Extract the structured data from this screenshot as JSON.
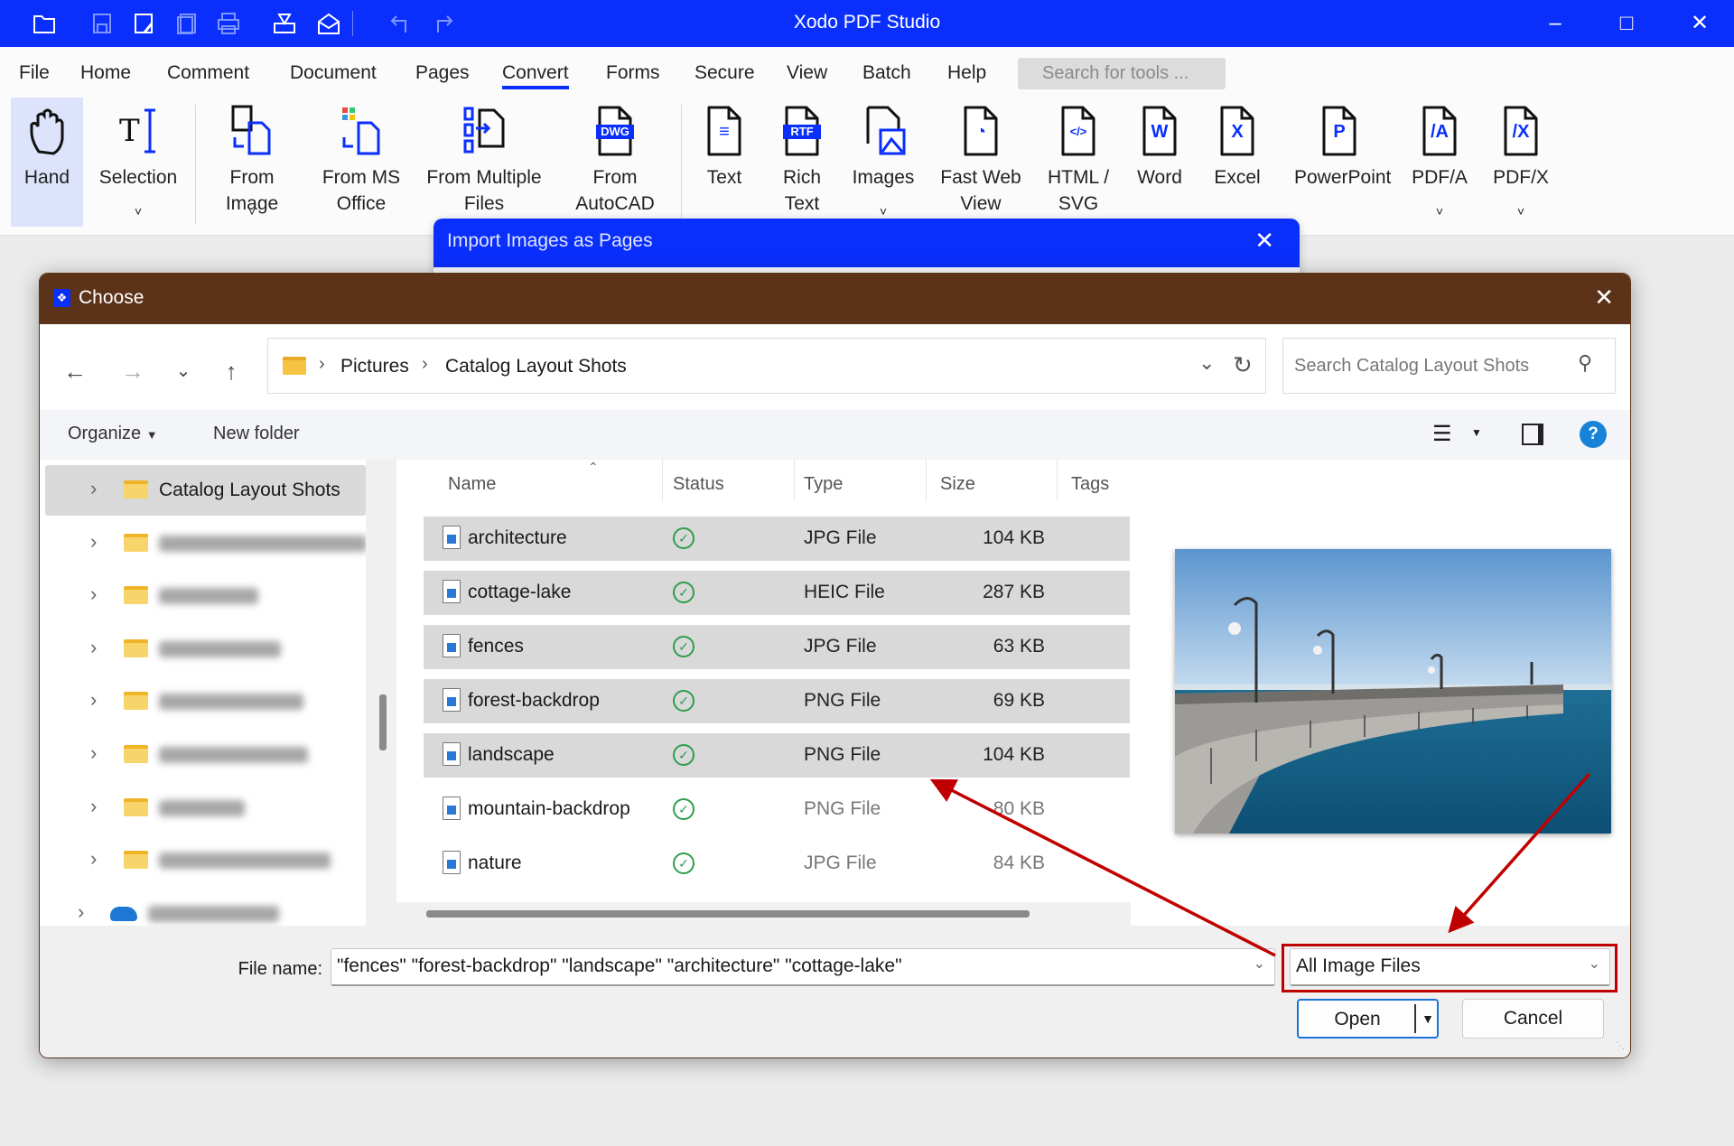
{
  "app": {
    "title": "Xodo PDF Studio"
  },
  "quick_access": [
    "open-folder",
    "save",
    "save-as",
    "save-all",
    "print",
    "scan",
    "email",
    "undo",
    "redo"
  ],
  "menu": {
    "items": [
      "File",
      "Home",
      "Comment",
      "Document",
      "Pages",
      "Convert",
      "Forms",
      "Secure",
      "View",
      "Batch",
      "Help"
    ],
    "active": "Convert",
    "search_placeholder": "Search for tools ..."
  },
  "ribbon": [
    {
      "label": "Hand",
      "icon": "hand",
      "active": true
    },
    {
      "label": "Selection",
      "icon": "text-select",
      "dropdown": true
    },
    {
      "label": "From\nImage",
      "icon": "image-to-pdf",
      "dropdown": true
    },
    {
      "label": "From MS\nOffice",
      "icon": "office-to-pdf"
    },
    {
      "label": "From Multiple\nFiles",
      "icon": "multiple-files"
    },
    {
      "label": "From\nAutoCAD",
      "icon": "dwg-file",
      "badge": "DWG"
    },
    {
      "label": "Text",
      "icon": "text-file",
      "badge": "≡"
    },
    {
      "label": "Rich\nText",
      "icon": "rtf-file",
      "badge": "RTF"
    },
    {
      "label": "Images",
      "icon": "images-file",
      "dropdown": true
    },
    {
      "label": "Fast Web\nView",
      "icon": "fast-web-view",
      "badge": "◔"
    },
    {
      "label": "HTML /\nSVG",
      "icon": "html-file",
      "badge": "</>"
    },
    {
      "label": "Word",
      "icon": "word-file",
      "badge": "W"
    },
    {
      "label": "Excel",
      "icon": "excel-file",
      "badge": "X"
    },
    {
      "label": "PowerPoint",
      "icon": "powerpoint-file",
      "badge": "P"
    },
    {
      "label": "PDF/A",
      "icon": "pdfa-file",
      "badge": "/A",
      "dropdown": true
    },
    {
      "label": "PDF/X",
      "icon": "pdfx-file",
      "badge": "/X",
      "dropdown": true
    }
  ],
  "import_dialog": {
    "title": "Import Images as Pages"
  },
  "choose_dialog": {
    "title": "Choose",
    "breadcrumb": [
      "Pictures",
      "Catalog Layout Shots"
    ],
    "search_placeholder": "Search Catalog Layout Shots",
    "organize": "Organize",
    "new_folder": "New folder",
    "tree": {
      "selected": "Catalog Layout Shots"
    },
    "columns": [
      "Name",
      "Status",
      "Type",
      "Size",
      "Tags"
    ],
    "files": [
      {
        "name": "architecture",
        "type": "JPG File",
        "size": "104 KB",
        "selected": true
      },
      {
        "name": "cottage-lake",
        "type": "HEIC File",
        "size": "287 KB",
        "selected": true
      },
      {
        "name": "fences",
        "type": "JPG File",
        "size": "63 KB",
        "selected": true
      },
      {
        "name": "forest-backdrop",
        "type": "PNG File",
        "size": "69 KB",
        "selected": true
      },
      {
        "name": "landscape",
        "type": "PNG File",
        "size": "104 KB",
        "selected": true
      },
      {
        "name": "mountain-backdrop",
        "type": "PNG File",
        "size": "80 KB",
        "selected": false
      },
      {
        "name": "nature",
        "type": "JPG File",
        "size": "84 KB",
        "selected": false
      }
    ],
    "file_name_label": "File name:",
    "file_name_value": "\"fences\" \"forest-backdrop\" \"landscape\" \"architecture\" \"cottage-lake\"",
    "file_type": "All Image Files",
    "open": "Open",
    "cancel": "Cancel"
  },
  "colors": {
    "brand": "#0a2ffc",
    "dialog_header": "#5c3319",
    "annotation": "#c00000",
    "status_ok": "#2e9e4b"
  }
}
